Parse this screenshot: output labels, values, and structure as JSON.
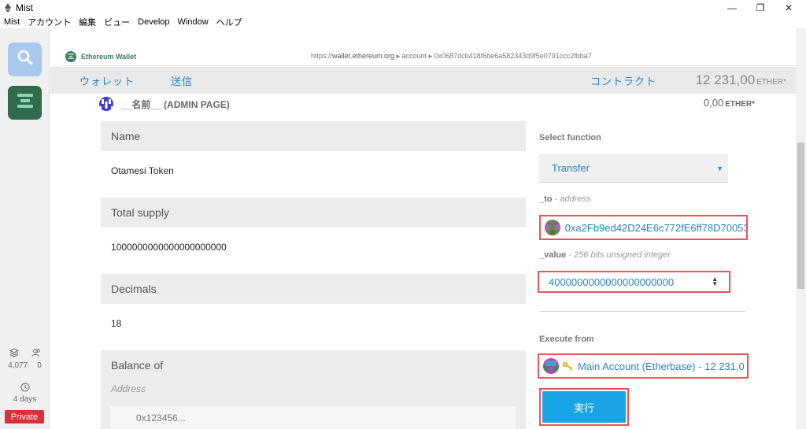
{
  "window": {
    "title": "Mist",
    "controls": {
      "minimize": "—",
      "restore": "❐",
      "close": "✕"
    }
  },
  "menu": [
    "Mist",
    "アカウント",
    "編集",
    "ビュー",
    "Develop",
    "Window",
    "ヘルプ"
  ],
  "rail": {
    "blocks": "4,077",
    "peers": "0",
    "time": "4 days",
    "network": "Private"
  },
  "browser": {
    "site_name": "Ethereum Wallet",
    "url_scheme": "https://",
    "url_host": "wallet.ethereum.org",
    "url_path": " ▸ account ▸ 0x0687dcb418f6be6a582343d9f5e0791ccc2fbba7"
  },
  "wallet_nav": {
    "wallet": "ウォレット",
    "send": "送信",
    "contracts": "コントラクト",
    "balance": "12 231,00",
    "unit": "ETHER*"
  },
  "page": {
    "title": "__名前__ (ADMIN PAGE)",
    "balance": "0,00",
    "unit": "ETHER*"
  },
  "fields": {
    "name_label": "Name",
    "name_value": "Otamesi Token",
    "supply_label": "Total supply",
    "supply_value": "1000000000000000000000",
    "decimals_label": "Decimals",
    "decimals_value": "18",
    "balance_label": "Balance of",
    "address_label": "Address",
    "address_placeholder": "0x123456..."
  },
  "function_panel": {
    "select_label": "Select function",
    "selected_function": "Transfer",
    "to_prefix": "_to",
    "to_hint": " - address",
    "to_value": "0xa2Fb9ed42D24E6c772fE6ff78D70053",
    "value_prefix": "_value",
    "value_hint": " - 256 bits unsigned integer",
    "value_value": "4000000000000000000000",
    "execute_label": "Execute from",
    "execute_account": "Main Account (Etherbase) - 12 231,0",
    "execute_button": "実行"
  },
  "colors": {
    "accent_blue": "#2a82c4",
    "highlight_red": "#e8535b",
    "button_blue": "#1aa4e8",
    "private_red": "#d9303a",
    "wallet_green": "#2f6b4c"
  }
}
